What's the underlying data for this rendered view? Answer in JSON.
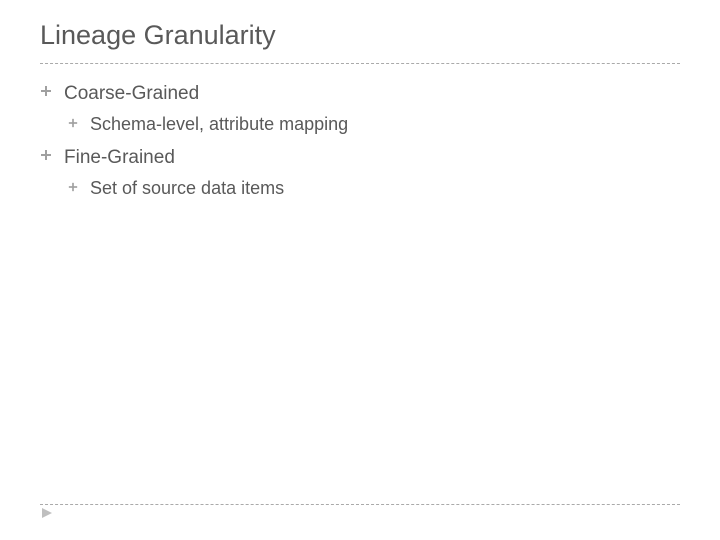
{
  "title": "Lineage Granularity",
  "bullets": [
    {
      "label": "Coarse-Grained",
      "children": [
        {
          "label": "Schema-level, attribute mapping"
        }
      ]
    },
    {
      "label": "Fine-Grained",
      "children": [
        {
          "label": "Set of source data items"
        }
      ]
    }
  ]
}
